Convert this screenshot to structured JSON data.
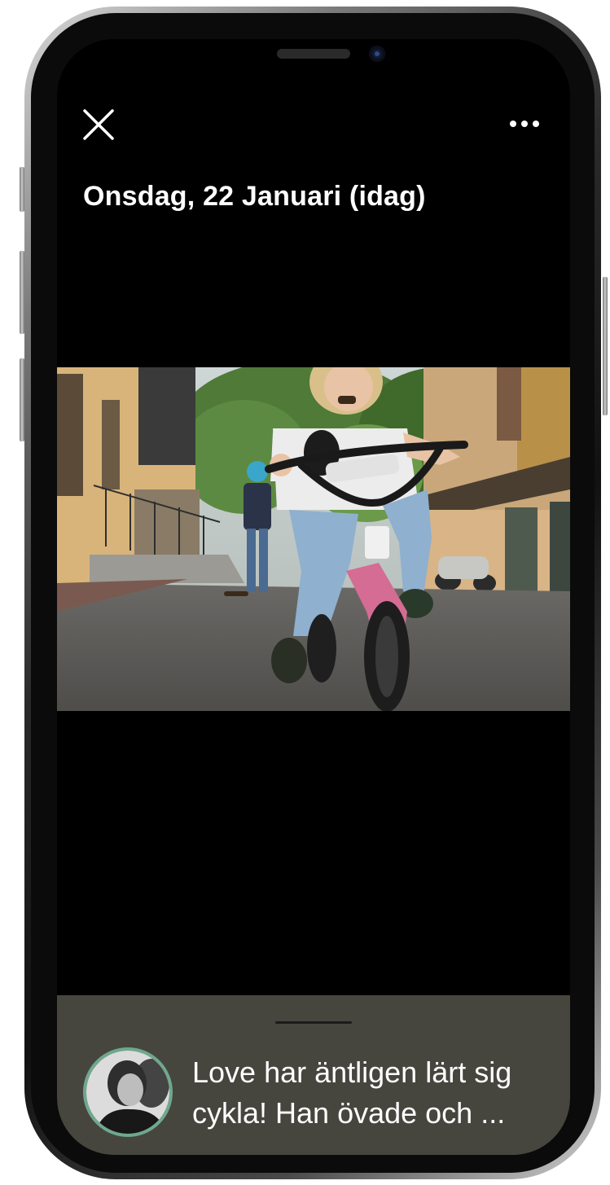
{
  "header": {
    "date_title": "Onsdag, 22 Januari (idag)"
  },
  "icons": {
    "close": "close-icon",
    "more": "more-horizontal-icon"
  },
  "post": {
    "caption_line1": "Love har äntligen lärt sig",
    "caption_line2": "cykla! Han övade och ..."
  },
  "colors": {
    "screen_background": "#000000",
    "sheet_background": "#46463f",
    "avatar_ring": "#6fa88e",
    "text": "#ffffff"
  }
}
